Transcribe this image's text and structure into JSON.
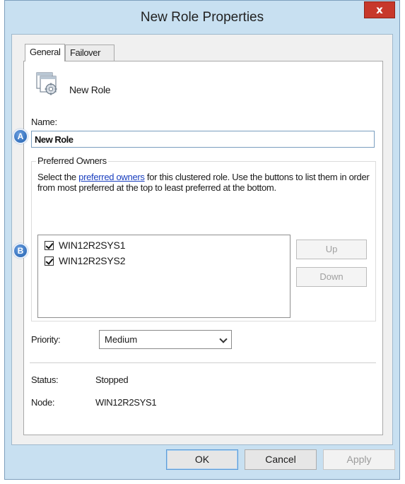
{
  "window": {
    "title": "New Role Properties",
    "close_label": "x"
  },
  "tabs": [
    {
      "label": "General",
      "active": true
    },
    {
      "label": "Failover",
      "active": false
    }
  ],
  "role": {
    "icon": "cluster-role-icon",
    "name": "New Role"
  },
  "name_field": {
    "label": "Name:",
    "value": "New Role"
  },
  "preferred_owners": {
    "title": "Preferred Owners",
    "desc_before": "Select the ",
    "link": "preferred owners",
    "desc_after": " for this clustered role. Use the buttons to list them in order from most preferred at the top to least preferred at the bottom.",
    "owners": [
      {
        "name": "WIN12R2SYS1",
        "checked": true
      },
      {
        "name": "WIN12R2SYS2",
        "checked": true
      }
    ],
    "up_label": "Up",
    "down_label": "Down"
  },
  "priority": {
    "label": "Priority:",
    "value": "Medium"
  },
  "status": {
    "label": "Status:",
    "value": "Stopped"
  },
  "node": {
    "label": "Node:",
    "value": "WIN12R2SYS1"
  },
  "buttons": {
    "ok": "OK",
    "cancel": "Cancel",
    "apply": "Apply"
  },
  "callouts": {
    "a": "A",
    "b": "B"
  },
  "colors": {
    "title_bar": "#c8e0f1",
    "link": "#1a3fbf",
    "close": "#c7382b",
    "callout": "#1f5fae"
  }
}
